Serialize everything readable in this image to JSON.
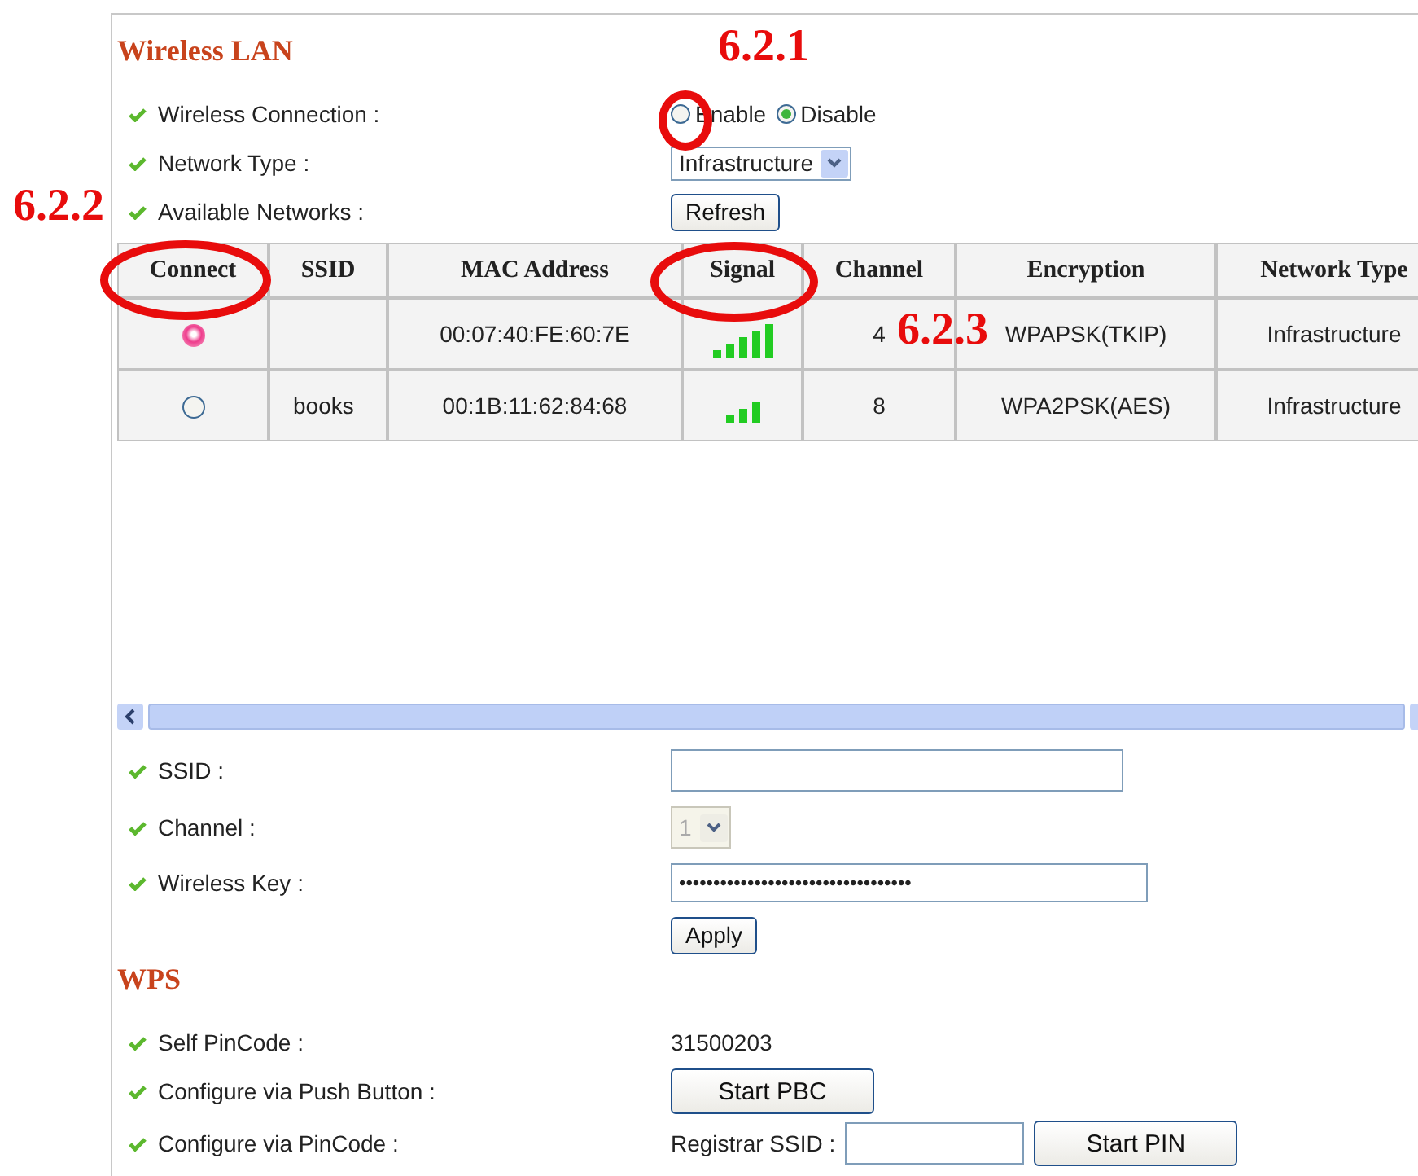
{
  "wireless_lan": {
    "title": "Wireless LAN",
    "wireless_connection": {
      "label": "Wireless Connection :",
      "options": [
        {
          "label": "Enable",
          "selected": false
        },
        {
          "label": "Disable",
          "selected": true
        }
      ]
    },
    "network_type": {
      "label": "Network Type :",
      "value": "Infrastructure"
    },
    "available_networks": {
      "label": "Available Networks :",
      "button": "Refresh"
    },
    "table": {
      "columns": [
        "Connect",
        "SSID",
        "MAC Address",
        "Signal",
        "Channel",
        "Encryption",
        "Network Type"
      ],
      "rows": [
        {
          "selected": true,
          "mac": "00:07:40:FE:60:7E",
          "signal": {
            "kind": "strong"
          },
          "channel": "4",
          "encryption": "WPAPSK(TKIP)",
          "network_type": "Infrastructure"
        },
        {
          "selected": false,
          "ssid": "books",
          "mac": "00:1B:11:62:84:68",
          "signal": {
            "kind": "medium"
          },
          "channel": "8",
          "encryption": "WPA2PSK(AES)",
          "network_type": "Infrastructure"
        }
      ]
    },
    "ssid": {
      "label": "SSID :"
    },
    "channel": {
      "label": "Channel :",
      "value": "1",
      "disabled": true
    },
    "wireless_key": {
      "label": "Wireless Key :",
      "value": "••••••••••••••••••••••••••••••••••"
    },
    "apply_button": "Apply"
  },
  "wps": {
    "title": "WPS",
    "self_pincode": {
      "label": "Self PinCode :",
      "value": "31500203"
    },
    "push_button": {
      "label": "Configure via Push Button :",
      "button": "Start PBC"
    },
    "pincode": {
      "label": "Configure via PinCode :",
      "registrar_label": "Registrar SSID :",
      "button": "Start PIN"
    }
  },
  "annotations": [
    {
      "label": "6.2.1"
    },
    {
      "label": "6.2.2"
    },
    {
      "label": "6.2.3"
    }
  ]
}
